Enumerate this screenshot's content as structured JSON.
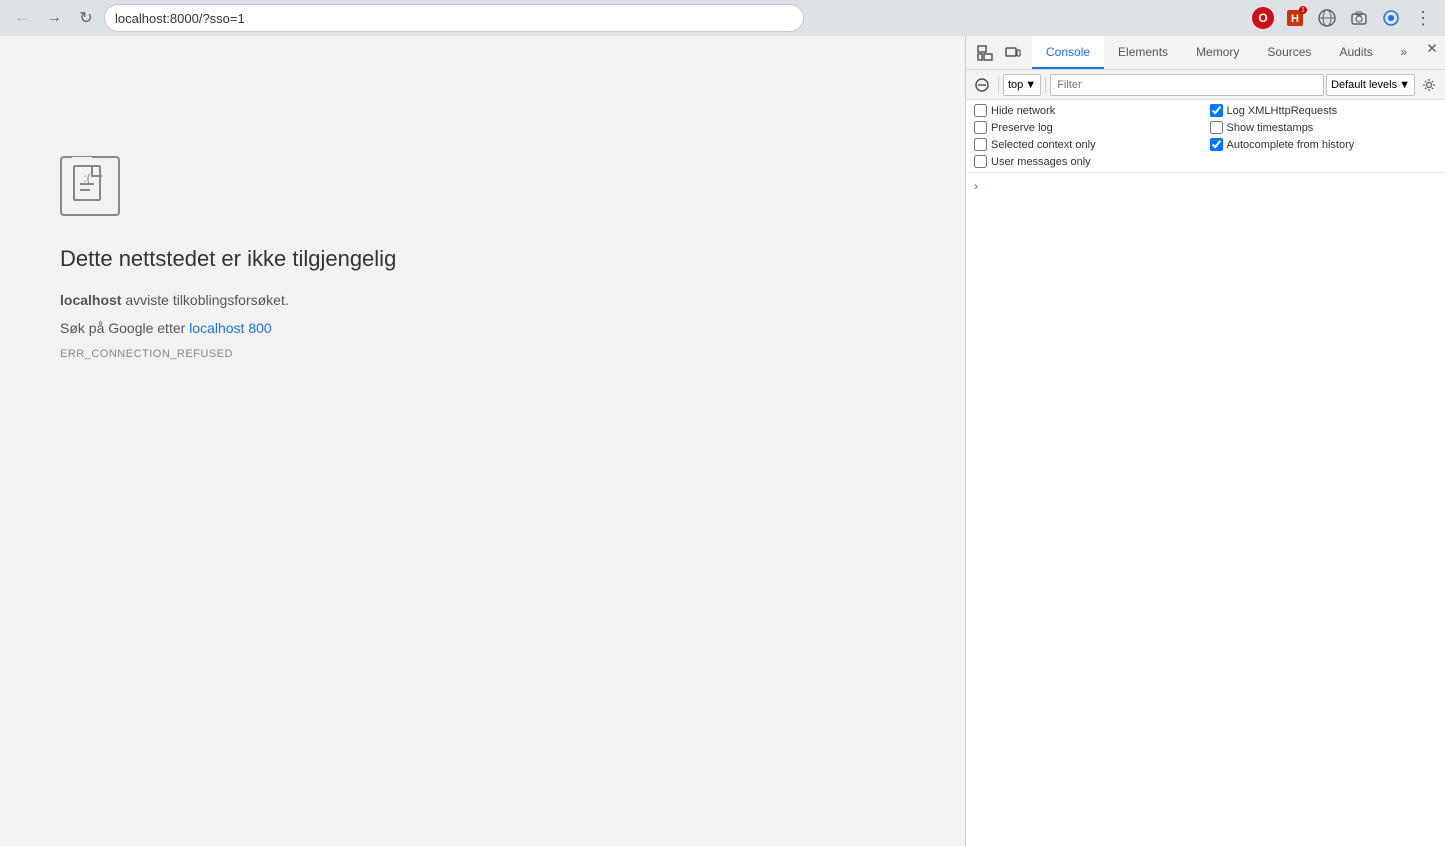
{
  "browser": {
    "url": "localhost:8000/?sso=1",
    "back_btn": "←",
    "forward_btn": "→",
    "reload_btn": "↻"
  },
  "page": {
    "title": "Dette nettstedet er ikke tilgjengelig",
    "description_prefix": "localhost",
    "description_suffix": " avviste tilkoblingsforsøket.",
    "search_text": "Søk på Google etter ",
    "search_link": "localhost 800",
    "error_code": "ERR_CONNECTION_REFUSED"
  },
  "devtools": {
    "tabs": [
      {
        "label": "Console",
        "active": true
      },
      {
        "label": "Elements",
        "active": false
      },
      {
        "label": "Memory",
        "active": false
      },
      {
        "label": "Sources",
        "active": false
      },
      {
        "label": "Audits",
        "active": false
      }
    ],
    "toolbar": {
      "context_value": "top",
      "filter_placeholder": "Filter",
      "levels_label": "Default levels"
    },
    "checkboxes": [
      {
        "id": "cb1",
        "label": "Hide network",
        "checked": false,
        "col": 1
      },
      {
        "id": "cb2",
        "label": "Log XMLHttpRequests",
        "checked": true,
        "col": 2
      },
      {
        "id": "cb3",
        "label": "Preserve log",
        "checked": false,
        "col": 1
      },
      {
        "id": "cb4",
        "label": "Show timestamps",
        "checked": false,
        "col": 2
      },
      {
        "id": "cb5",
        "label": "Selected context only",
        "checked": false,
        "col": 1
      },
      {
        "id": "cb6",
        "label": "Autocomplete from history",
        "checked": true,
        "col": 2
      },
      {
        "id": "cb7",
        "label": "User messages only",
        "checked": false,
        "col": 1
      }
    ],
    "console_arrow": "›"
  }
}
